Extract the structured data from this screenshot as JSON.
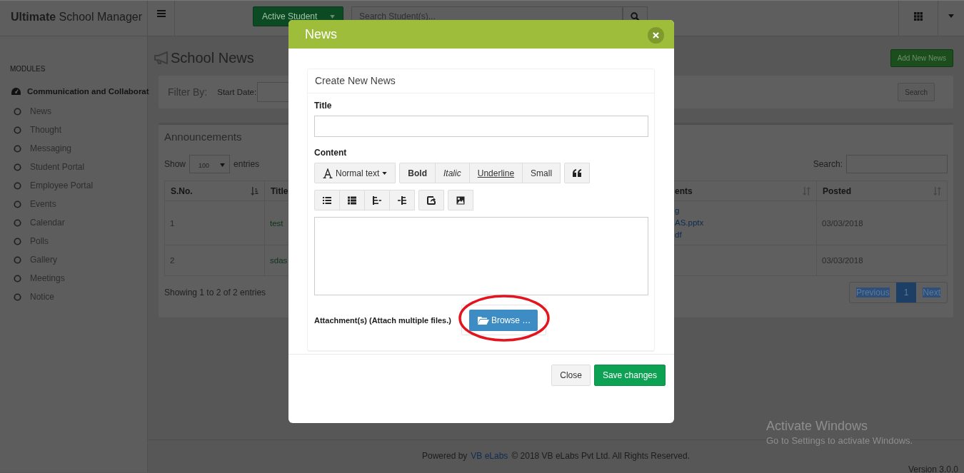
{
  "header": {
    "brand": "**Ultimate** School Manager",
    "student_filter": "Active Student",
    "search_placeholder": "Search Student(s)..."
  },
  "sidebar": {
    "heading": "MODULES",
    "group": {
      "label": "Communication and Collaborat",
      "items": [
        {
          "label": "News"
        },
        {
          "label": "Thought"
        },
        {
          "label": "Messaging"
        },
        {
          "label": "Student Portal"
        },
        {
          "label": "Employee Portal"
        },
        {
          "label": "Events"
        },
        {
          "label": "Calendar"
        },
        {
          "label": "Polls"
        },
        {
          "label": "Gallery"
        },
        {
          "label": "Meetings"
        },
        {
          "label": "Notice"
        }
      ]
    }
  },
  "page": {
    "title": "School News",
    "add_button": "Add New News"
  },
  "filter": {
    "label": "Filter By:",
    "start_date_label": "Start Date:",
    "search_button": "Search"
  },
  "announcements": {
    "title": "Announcements",
    "show_label": "Show",
    "page_size": "100",
    "entries_label": "entries",
    "search_label": "Search:",
    "columns": [
      {
        "label": "S.No.",
        "sorted": true
      },
      {
        "label": "Title"
      },
      {
        "label": "ents",
        "sorted": false
      },
      {
        "label": "Posted",
        "sorted": false
      }
    ],
    "rows": [
      {
        "sno": "1",
        "title": "test",
        "attachments": [
          "g",
          "AS.pptx",
          "df"
        ],
        "posted": "03/03/2018"
      },
      {
        "sno": "2",
        "title": "sdas",
        "posted": "03/03/2018"
      }
    ],
    "info": "Showing 1 to 2 of 2 entries",
    "pagination": [
      {
        "label": "Previous",
        "selected": false
      },
      {
        "label": "1",
        "selected": true
      },
      {
        "label": "Next",
        "selected": false
      }
    ]
  },
  "modal": {
    "title": "News",
    "panel_title": "Create New News",
    "title_label": "Title",
    "content_label": "Content",
    "toolbar": [
      [
        {
          "kind": "dropdown",
          "label": "Normal text"
        }
      ],
      [
        {
          "kind": "bold",
          "label": "Bold"
        },
        {
          "kind": "italic",
          "label": "Italic"
        },
        {
          "kind": "underline",
          "label": "Underline"
        },
        {
          "kind": "small",
          "label": "Small"
        }
      ],
      [
        {
          "kind": "quote"
        }
      ],
      [
        {
          "kind": "bullets"
        },
        {
          "kind": "numbers"
        },
        {
          "kind": "outdent"
        },
        {
          "kind": "indent"
        }
      ],
      [
        {
          "kind": "share"
        }
      ],
      [
        {
          "kind": "image"
        }
      ]
    ],
    "attachment_label": "Attachment(s) (Attach multiple files.)",
    "browse_button": "Browse …",
    "annotation": {
      "kind": "ellipse"
    },
    "buttons": [
      {
        "label": "Close",
        "kind": "default"
      },
      {
        "label": "Save changes",
        "kind": "primary"
      }
    ]
  },
  "footer": {
    "powered_by": "Powered by",
    "company_link": "VB eLabs",
    "copyright": "© 2018 VB eLabs Pvt Ltd. All Rights Reserved.",
    "version": "Version 3.0.0"
  },
  "os_notice": {
    "title": "Activate Windows",
    "text": "Go to Settings to activate Windows."
  }
}
